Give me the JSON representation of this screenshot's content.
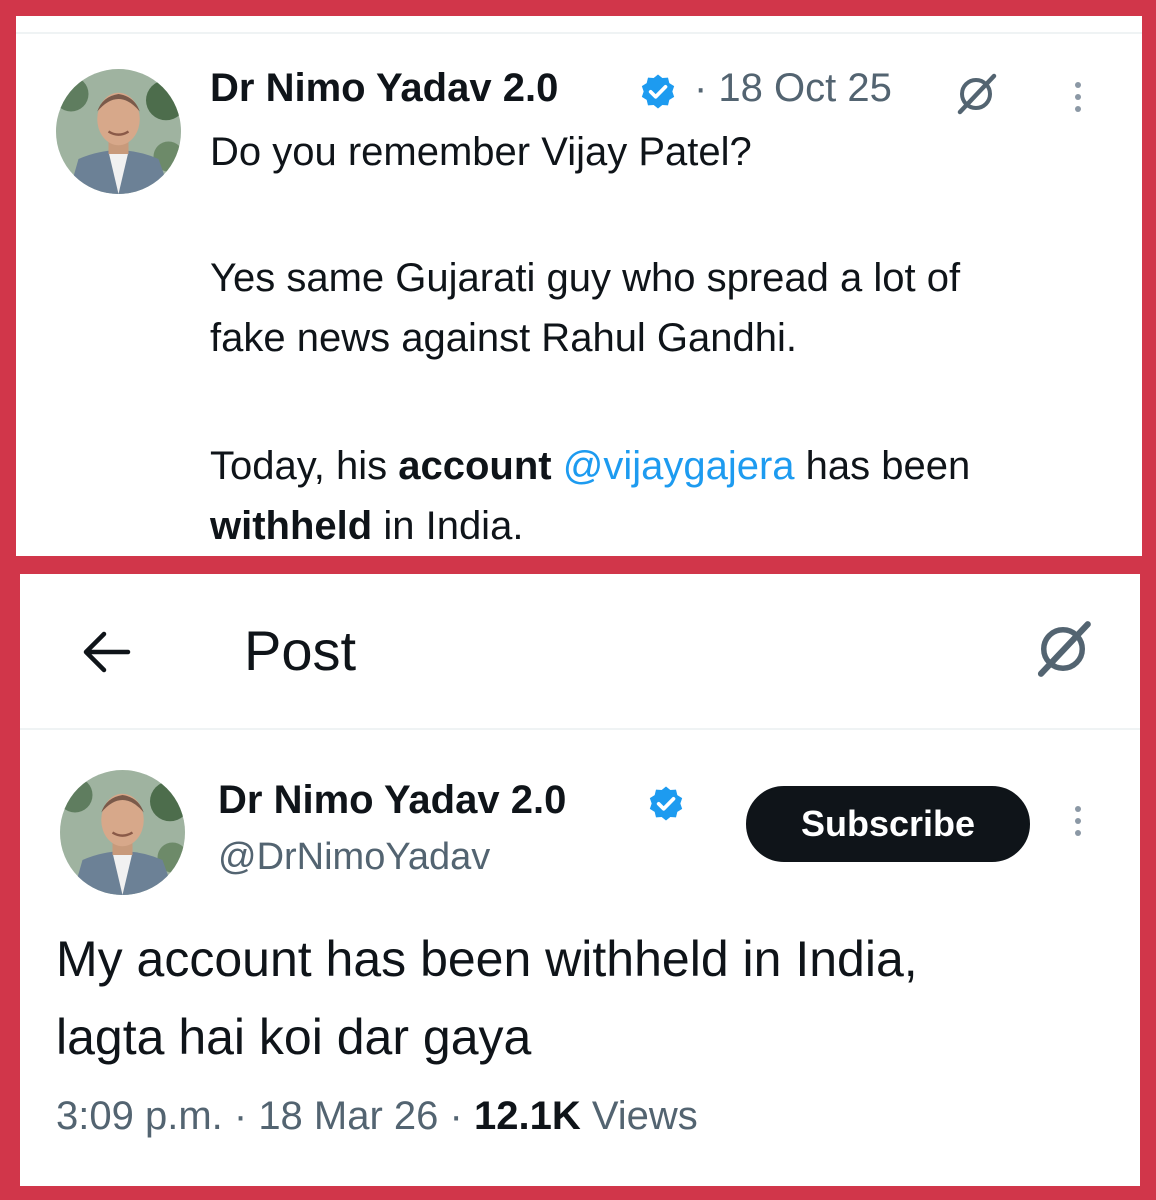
{
  "colors": {
    "frame": "#d1364a",
    "text": "#0f1419",
    "secondary": "#536471",
    "link": "#1d9bf0",
    "verified": "#1d9bf0"
  },
  "top_tweet": {
    "author": "Dr Nimo Yadav 2.0",
    "date": "· 18 Oct 25",
    "icons": [
      "avatar",
      "verified-badge-icon",
      "grok-icon",
      "more-vertical-icon"
    ],
    "line1": "Do you remember Vijay Patel?",
    "line2": "Yes same Gujarati guy who spread a lot of",
    "line3": "fake news against Rahul Gandhi.",
    "line4_part1": "Today, his ",
    "line4_bold": "account",
    "line4_space": " ",
    "line4_mention": "@vijaygajera",
    "line4_part2": " has been",
    "line5_bold": "withheld",
    "line5_rest": " in India."
  },
  "post_view": {
    "header": {
      "title": "Post",
      "icons": [
        "back-arrow-icon",
        "grok-icon"
      ]
    },
    "author": {
      "name": "Dr Nimo Yadav 2.0",
      "handle": "@DrNimoYadav"
    },
    "subscribe_label": "Subscribe",
    "body_line1": "My account has been withheld in India,",
    "body_line2": "lagta hai koi dar gaya",
    "time": "3:09 p.m.",
    "sep1": " · ",
    "date": "18 Mar 26",
    "sep2": " · ",
    "views_count": "12.1K",
    "views_label": " Views"
  }
}
